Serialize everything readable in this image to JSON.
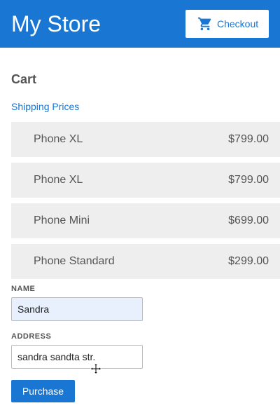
{
  "header": {
    "brand": "My Store",
    "checkout_label": "Checkout",
    "accent_color": "#1976d2"
  },
  "cart": {
    "title": "Cart",
    "shipping_link": "Shipping Prices",
    "items": [
      {
        "name": "Phone XL",
        "price": "$799.00"
      },
      {
        "name": "Phone XL",
        "price": "$799.00"
      },
      {
        "name": "Phone Mini",
        "price": "$699.00"
      },
      {
        "name": "Phone Standard",
        "price": "$299.00"
      }
    ]
  },
  "form": {
    "name_label": "NAME",
    "name_value": "Sandra",
    "address_label": "ADDRESS",
    "address_value": "sandra sandta str.",
    "purchase_label": "Purchase"
  },
  "icons": {
    "checkout": "shopping-cart-icon",
    "cursor": "move-cursor-icon"
  }
}
